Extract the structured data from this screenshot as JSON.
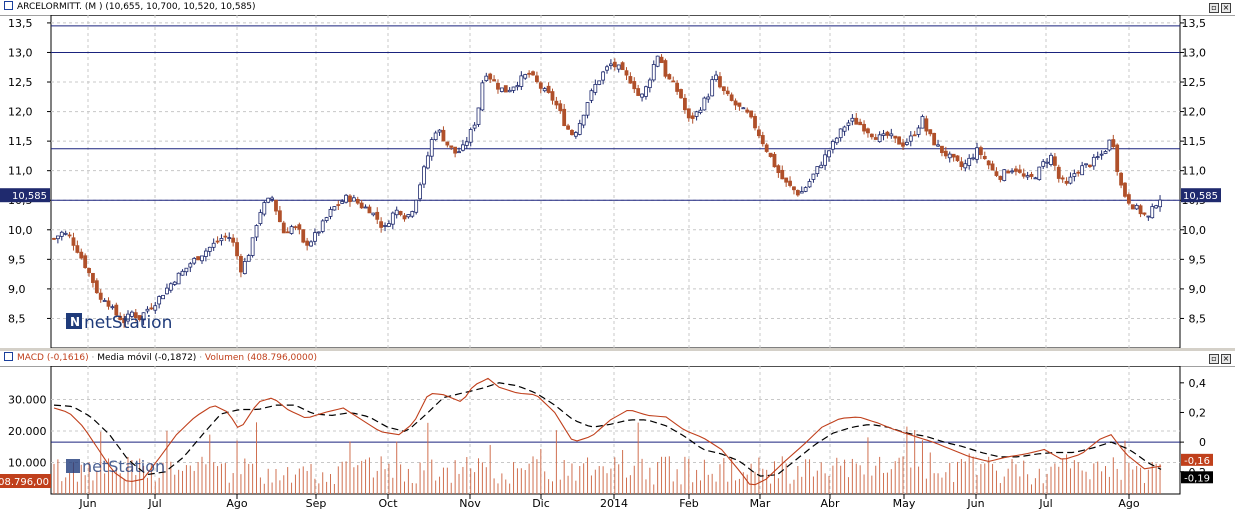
{
  "price_panel": {
    "title": "ARCELORMITT. (M ) (10,655, 10,700, 10,520, 10,585)",
    "last_price_label": "10,585",
    "watermark": "netStation",
    "y_ticks": [
      "13,5",
      "13,0",
      "12,5",
      "12,0",
      "11,5",
      "11,0",
      "10,5",
      "10,0",
      "9,5",
      "9,0",
      "8,5"
    ]
  },
  "macd_panel": {
    "title_macd": "MACD (-0,1616)",
    "title_ma": "Media móvil (-0,1872)",
    "title_vol": "Volumen (408.796,0000)",
    "watermark": "netStation",
    "left_ticks": [
      "30.000",
      "20.000",
      "10.000"
    ],
    "right_ticks": [
      "0,4",
      "0,2",
      "0",
      "-0,2"
    ],
    "macd_badge": "-0,16",
    "ma_badge": "-0,19",
    "volume_badge": "408.796,00"
  },
  "x_labels": [
    "Jun",
    "Jul",
    "Ago",
    "Sep",
    "Oct",
    "Nov",
    "Dic",
    "2014",
    "Feb",
    "Mar",
    "Abr",
    "May",
    "Jun",
    "Jul",
    "Ago"
  ],
  "colors": {
    "up_candle": "#1f2a6e",
    "down_candle": "#b0502a",
    "macd_line": "#c0401c",
    "ma_line": "#000000",
    "volume_bar": "#d07050",
    "hline": "#1a237e",
    "title_accent": "#c0401c"
  },
  "chart_data": [
    {
      "type": "candlestick",
      "title": "ARCELORMITT. (M ) (10,655, 10,700, 10,520, 10,585)",
      "ylim": [
        8.0,
        13.6
      ],
      "horizontal_lines": [
        13.45,
        13.0,
        11.37,
        10.5
      ],
      "last": {
        "open": 10.655,
        "high": 10.7,
        "low": 10.52,
        "close": 10.585
      },
      "months": [
        "Jun",
        "Jul",
        "Ago",
        "Sep",
        "Oct",
        "Nov",
        "Dic",
        "2014",
        "Feb",
        "Mar",
        "Abr",
        "May",
        "Jun",
        "Jul",
        "Ago"
      ],
      "close_path": [
        [
          0,
          9.85
        ],
        [
          4,
          9.95
        ],
        [
          8,
          9.9
        ],
        [
          12,
          9.7
        ],
        [
          16,
          9.45
        ],
        [
          20,
          9.2
        ],
        [
          24,
          8.9
        ],
        [
          26,
          8.75
        ],
        [
          28,
          8.9
        ],
        [
          30,
          8.7
        ],
        [
          34,
          8.55
        ],
        [
          38,
          8.45
        ],
        [
          42,
          8.6
        ],
        [
          46,
          8.5
        ],
        [
          50,
          8.65
        ],
        [
          54,
          8.75
        ],
        [
          58,
          8.9
        ],
        [
          62,
          9.05
        ],
        [
          66,
          9.2
        ],
        [
          70,
          9.3
        ],
        [
          74,
          9.45
        ],
        [
          78,
          9.55
        ],
        [
          82,
          9.65
        ],
        [
          86,
          9.75
        ],
        [
          90,
          9.85
        ],
        [
          94,
          9.9
        ],
        [
          98,
          9.7
        ],
        [
          100,
          9.3
        ],
        [
          104,
          9.5
        ],
        [
          108,
          9.9
        ],
        [
          110,
          10.25
        ],
        [
          114,
          10.45
        ],
        [
          118,
          10.55
        ],
        [
          120,
          10.3
        ],
        [
          124,
          9.95
        ],
        [
          128,
          10.05
        ],
        [
          132,
          10.0
        ],
        [
          134,
          9.75
        ],
        [
          138,
          9.8
        ],
        [
          142,
          9.95
        ],
        [
          146,
          10.15
        ],
        [
          150,
          10.35
        ],
        [
          154,
          10.45
        ],
        [
          158,
          10.55
        ],
        [
          162,
          10.5
        ],
        [
          166,
          10.4
        ],
        [
          170,
          10.35
        ],
        [
          174,
          10.2
        ],
        [
          178,
          10.0
        ],
        [
          182,
          10.25
        ],
        [
          186,
          10.35
        ],
        [
          190,
          10.2
        ],
        [
          194,
          10.4
        ],
        [
          198,
          10.85
        ],
        [
          202,
          11.3
        ],
        [
          204,
          11.55
        ],
        [
          206,
          11.7
        ],
        [
          208,
          11.65
        ],
        [
          212,
          11.45
        ],
        [
          216,
          11.3
        ],
        [
          220,
          11.35
        ],
        [
          224,
          11.6
        ],
        [
          228,
          11.9
        ],
        [
          230,
          12.3
        ],
        [
          232,
          12.7
        ],
        [
          236,
          12.55
        ],
        [
          240,
          12.4
        ],
        [
          244,
          12.35
        ],
        [
          248,
          12.45
        ],
        [
          252,
          12.55
        ],
        [
          256,
          12.65
        ],
        [
          260,
          12.5
        ],
        [
          264,
          12.35
        ],
        [
          268,
          12.25
        ],
        [
          272,
          12.05
        ],
        [
          276,
          11.75
        ],
        [
          280,
          11.6
        ],
        [
          284,
          11.85
        ],
        [
          288,
          12.2
        ],
        [
          292,
          12.45
        ],
        [
          296,
          12.65
        ],
        [
          300,
          12.8
        ],
        [
          304,
          12.75
        ],
        [
          308,
          12.6
        ],
        [
          312,
          12.5
        ],
        [
          316,
          12.2
        ],
        [
          320,
          12.45
        ],
        [
          324,
          12.85
        ],
        [
          326,
          13.0
        ],
        [
          328,
          12.8
        ],
        [
          330,
          12.6
        ],
        [
          334,
          12.45
        ],
        [
          338,
          12.25
        ],
        [
          342,
          11.85
        ],
        [
          346,
          11.95
        ],
        [
          350,
          12.15
        ],
        [
          354,
          12.35
        ],
        [
          356,
          12.7
        ],
        [
          358,
          12.45
        ],
        [
          362,
          12.3
        ],
        [
          366,
          12.15
        ],
        [
          370,
          12.05
        ],
        [
          374,
          11.95
        ],
        [
          378,
          11.75
        ],
        [
          382,
          11.5
        ],
        [
          386,
          11.25
        ],
        [
          390,
          11.0
        ],
        [
          394,
          10.8
        ],
        [
          398,
          10.7
        ],
        [
          402,
          10.6
        ],
        [
          406,
          10.75
        ],
        [
          410,
          10.95
        ],
        [
          414,
          11.15
        ],
        [
          418,
          11.35
        ],
        [
          422,
          11.55
        ],
        [
          426,
          11.75
        ],
        [
          430,
          11.85
        ],
        [
          434,
          11.8
        ],
        [
          438,
          11.7
        ],
        [
          442,
          11.6
        ],
        [
          446,
          11.55
        ],
        [
          450,
          11.6
        ],
        [
          454,
          11.5
        ],
        [
          458,
          11.45
        ],
        [
          462,
          11.55
        ],
        [
          466,
          11.75
        ],
        [
          468,
          11.9
        ],
        [
          470,
          11.7
        ],
        [
          474,
          11.5
        ],
        [
          478,
          11.35
        ],
        [
          482,
          11.25
        ],
        [
          486,
          11.15
        ],
        [
          490,
          11.05
        ],
        [
          494,
          11.2
        ],
        [
          498,
          11.35
        ],
        [
          502,
          11.2
        ],
        [
          506,
          11.0
        ],
        [
          510,
          10.9
        ],
        [
          514,
          11.0
        ],
        [
          518,
          11.05
        ],
        [
          522,
          10.9
        ],
        [
          526,
          10.85
        ],
        [
          530,
          10.95
        ],
        [
          534,
          11.15
        ],
        [
          538,
          11.25
        ],
        [
          540,
          11.05
        ],
        [
          542,
          10.85
        ],
        [
          546,
          10.75
        ],
        [
          550,
          10.95
        ],
        [
          554,
          11.05
        ],
        [
          558,
          11.1
        ],
        [
          562,
          11.2
        ],
        [
          566,
          11.3
        ],
        [
          570,
          11.55
        ],
        [
          572,
          11.4
        ],
        [
          574,
          10.85
        ],
        [
          578,
          10.55
        ],
        [
          582,
          10.4
        ],
        [
          586,
          10.3
        ],
        [
          590,
          10.2
        ],
        [
          594,
          10.45
        ],
        [
          598,
          10.6
        ]
      ]
    },
    {
      "type": "line",
      "series": [
        {
          "name": "MACD (-0,1616)",
          "last": -0.1616
        },
        {
          "name": "Media móvil (-0,1872)",
          "last": -0.1872
        },
        {
          "name": "Volumen (408.796,0000)",
          "last": 408796.0
        }
      ],
      "ylim_right": [
        -0.35,
        0.5
      ],
      "ylim_left": [
        0,
        40000
      ],
      "macd_path": [
        [
          0,
          0.23
        ],
        [
          8,
          0.2
        ],
        [
          16,
          0.1
        ],
        [
          24,
          -0.05
        ],
        [
          32,
          -0.2
        ],
        [
          40,
          -0.27
        ],
        [
          48,
          -0.25
        ],
        [
          56,
          -0.12
        ],
        [
          66,
          0.05
        ],
        [
          76,
          0.17
        ],
        [
          86,
          0.25
        ],
        [
          94,
          0.2
        ],
        [
          100,
          0.08
        ],
        [
          110,
          0.27
        ],
        [
          118,
          0.3
        ],
        [
          126,
          0.22
        ],
        [
          136,
          0.16
        ],
        [
          146,
          0.2
        ],
        [
          156,
          0.23
        ],
        [
          166,
          0.15
        ],
        [
          176,
          0.07
        ],
        [
          186,
          0.05
        ],
        [
          194,
          0.13
        ],
        [
          202,
          0.33
        ],
        [
          210,
          0.32
        ],
        [
          220,
          0.27
        ],
        [
          226,
          0.38
        ],
        [
          234,
          0.43
        ],
        [
          240,
          0.37
        ],
        [
          250,
          0.33
        ],
        [
          260,
          0.32
        ],
        [
          270,
          0.2
        ],
        [
          280,
          0.0
        ],
        [
          290,
          0.04
        ],
        [
          300,
          0.15
        ],
        [
          310,
          0.22
        ],
        [
          320,
          0.18
        ],
        [
          330,
          0.17
        ],
        [
          340,
          0.08
        ],
        [
          350,
          0.03
        ],
        [
          360,
          -0.05
        ],
        [
          370,
          -0.2
        ],
        [
          376,
          -0.3
        ],
        [
          384,
          -0.25
        ],
        [
          394,
          -0.13
        ],
        [
          404,
          -0.02
        ],
        [
          414,
          0.1
        ],
        [
          424,
          0.16
        ],
        [
          434,
          0.17
        ],
        [
          444,
          0.13
        ],
        [
          454,
          0.08
        ],
        [
          464,
          0.04
        ],
        [
          474,
          0.0
        ],
        [
          484,
          -0.05
        ],
        [
          494,
          -0.1
        ],
        [
          504,
          -0.13
        ],
        [
          514,
          -0.1
        ],
        [
          524,
          -0.08
        ],
        [
          534,
          -0.05
        ],
        [
          544,
          -0.12
        ],
        [
          554,
          -0.08
        ],
        [
          564,
          0.02
        ],
        [
          570,
          0.05
        ],
        [
          578,
          -0.08
        ],
        [
          588,
          -0.18
        ],
        [
          598,
          -0.16
        ]
      ],
      "ma_path": [
        [
          0,
          0.25
        ],
        [
          10,
          0.24
        ],
        [
          20,
          0.17
        ],
        [
          30,
          0.05
        ],
        [
          40,
          -0.12
        ],
        [
          50,
          -0.22
        ],
        [
          60,
          -0.2
        ],
        [
          70,
          -0.1
        ],
        [
          80,
          0.05
        ],
        [
          90,
          0.19
        ],
        [
          100,
          0.22
        ],
        [
          110,
          0.22
        ],
        [
          120,
          0.25
        ],
        [
          130,
          0.25
        ],
        [
          140,
          0.19
        ],
        [
          150,
          0.18
        ],
        [
          160,
          0.2
        ],
        [
          170,
          0.17
        ],
        [
          180,
          0.1
        ],
        [
          190,
          0.07
        ],
        [
          200,
          0.18
        ],
        [
          210,
          0.3
        ],
        [
          220,
          0.33
        ],
        [
          230,
          0.36
        ],
        [
          240,
          0.4
        ],
        [
          250,
          0.38
        ],
        [
          260,
          0.33
        ],
        [
          270,
          0.25
        ],
        [
          280,
          0.15
        ],
        [
          290,
          0.1
        ],
        [
          300,
          0.12
        ],
        [
          310,
          0.15
        ],
        [
          320,
          0.15
        ],
        [
          330,
          0.11
        ],
        [
          340,
          0.04
        ],
        [
          350,
          -0.05
        ],
        [
          360,
          -0.08
        ],
        [
          370,
          -0.13
        ],
        [
          380,
          -0.23
        ],
        [
          390,
          -0.22
        ],
        [
          400,
          -0.12
        ],
        [
          410,
          -0.02
        ],
        [
          420,
          0.06
        ],
        [
          430,
          0.1
        ],
        [
          440,
          0.12
        ],
        [
          450,
          0.1
        ],
        [
          460,
          0.06
        ],
        [
          470,
          0.04
        ],
        [
          480,
          0.0
        ],
        [
          490,
          -0.03
        ],
        [
          500,
          -0.07
        ],
        [
          510,
          -0.1
        ],
        [
          520,
          -0.1
        ],
        [
          530,
          -0.08
        ],
        [
          540,
          -0.07
        ],
        [
          550,
          -0.07
        ],
        [
          560,
          -0.04
        ],
        [
          570,
          0.0
        ],
        [
          580,
          -0.05
        ],
        [
          590,
          -0.14
        ],
        [
          598,
          -0.19
        ]
      ]
    }
  ]
}
